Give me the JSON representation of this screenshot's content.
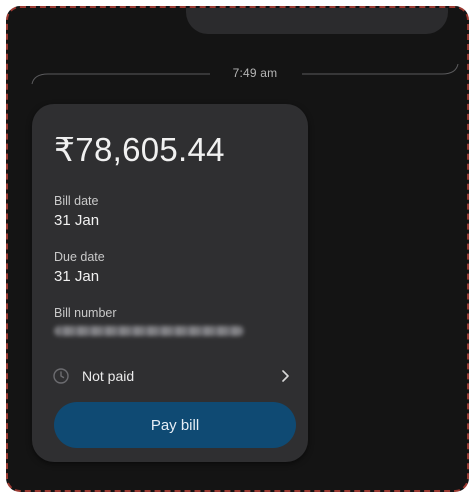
{
  "conversation": {
    "timestamp": "7:49 am"
  },
  "bill_card": {
    "amount": "₹78,605.44",
    "bill_date_label": "Bill date",
    "bill_date_value": "31 Jan",
    "due_date_label": "Due date",
    "due_date_value": "31 Jan",
    "bill_number_label": "Bill number",
    "status_icon": "clock-icon",
    "status_text": "Not paid",
    "status_chevron_icon": "chevron-right-icon",
    "pay_button_label": "Pay bill"
  },
  "colors": {
    "background": "#141414",
    "card": "#2f2f31",
    "pay_button": "#0f4a73",
    "frame_border": "#9c3a32"
  }
}
